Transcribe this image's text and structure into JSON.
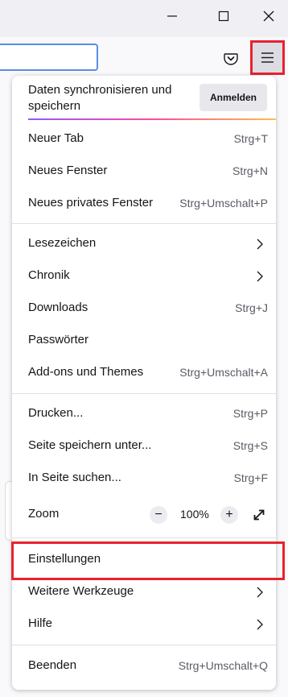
{
  "colors": {
    "accent": "#e8222f",
    "toolbar_bg": "#f9f9fb",
    "titlebar_bg": "#f0f0f4"
  },
  "window_controls": [
    "minimize-icon",
    "maximize-icon",
    "close-icon"
  ],
  "toolbar": {
    "pocket_icon": "pocket-icon",
    "menu_icon": "hamburger-menu-icon"
  },
  "sync": {
    "title": "Daten synchronisieren und speichern",
    "button": "Anmelden"
  },
  "menu": {
    "new_tab": {
      "label": "Neuer Tab",
      "shortcut": "Strg+T"
    },
    "new_window": {
      "label": "Neues Fenster",
      "shortcut": "Strg+N"
    },
    "private_window": {
      "label": "Neues privates Fenster",
      "shortcut": "Strg+Umschalt+P"
    },
    "bookmarks": {
      "label": "Lesezeichen"
    },
    "history": {
      "label": "Chronik"
    },
    "downloads": {
      "label": "Downloads",
      "shortcut": "Strg+J"
    },
    "passwords": {
      "label": "Passwörter"
    },
    "addons": {
      "label": "Add-ons und Themes",
      "shortcut": "Strg+Umschalt+A"
    },
    "print": {
      "label": "Drucken...",
      "shortcut": "Strg+P"
    },
    "save_page": {
      "label": "Seite speichern unter...",
      "shortcut": "Strg+S"
    },
    "find": {
      "label": "In Seite suchen...",
      "shortcut": "Strg+F"
    },
    "zoom": {
      "label": "Zoom",
      "minus": "−",
      "value": "100%",
      "plus": "+"
    },
    "settings": {
      "label": "Einstellungen"
    },
    "more_tools": {
      "label": "Weitere Werkzeuge"
    },
    "help": {
      "label": "Hilfe"
    },
    "quit": {
      "label": "Beenden",
      "shortcut": "Strg+Umschalt+Q"
    }
  }
}
